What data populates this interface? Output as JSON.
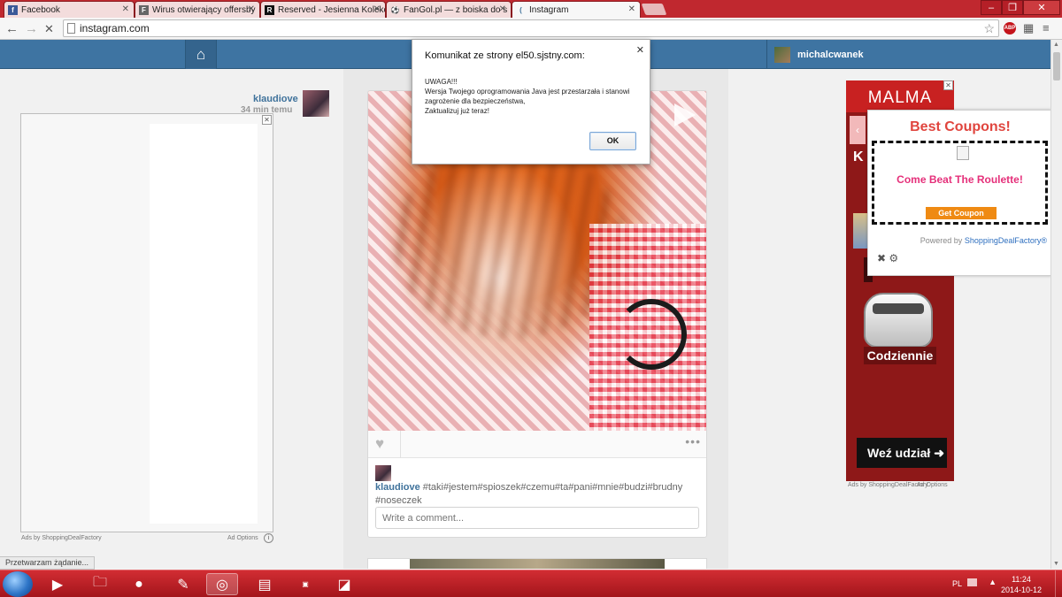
{
  "browser": {
    "tabs": [
      {
        "title": "Facebook",
        "favicon": "f",
        "favicon_color": "#3b5998"
      },
      {
        "title": "Wirus otwierający offersby",
        "favicon": "F",
        "favicon_color": "#666666"
      },
      {
        "title": "Reserved - Jesienna Kolekc",
        "favicon": "R",
        "favicon_color": "#111111"
      },
      {
        "title": "FanGol.pl — z boiska do s",
        "favicon": "⚽",
        "favicon_color": "#e3e3e3"
      },
      {
        "title": "Instagram",
        "favicon": "(",
        "favicon_color": "#3f729b",
        "active": true
      }
    ],
    "address": "instagram.com",
    "status_text": "Przetwarzam żądanie..."
  },
  "instagram": {
    "header_user": "michalcwanek",
    "post": {
      "user": "klaudiove",
      "time": "34 min temu",
      "caption": "#taki#jestem#spioszek#czemu#ta#pani#mnie#budzi#brudny #noseczek",
      "comment_placeholder": "Write a comment..."
    }
  },
  "ads": {
    "left_ads_by": "Ads by ShoppingDealFactory",
    "left_ad_options": "Ad Options",
    "right_ads_by": "Ads by ShoppingDealFactory",
    "right_ad_options": "Ad Options",
    "right_banner": {
      "brand": "MALMA",
      "letter": "K",
      "cta_daily": "Codziennie",
      "cta_join": "Weź udział ➜"
    },
    "coupon": {
      "title": "Best Coupons!",
      "headline": "Come Beat The Roulette!",
      "button": "Get Coupon",
      "powered_prefix": "Powered by ",
      "powered_brand": "ShoppingDealFactory®"
    }
  },
  "dialog": {
    "title": "Komunikat ze strony el50.sjstny.com:",
    "message": "UWAGA!!!\nWersja Twojego oprogramowania Java jest przestarzała i stanowi zagrożenie dla bezpieczeństwa,\nZaktualizuj już teraz!",
    "ok_label": "OK"
  },
  "taskbar": {
    "lang": "PL",
    "time": "11:24",
    "date": "2014-10-12",
    "pinned": [
      "media-player-icon",
      "explorer-icon",
      "security-icon",
      "pin-icon",
      "chrome-icon",
      "archive-icon",
      "gmer-icon",
      "network-icon"
    ]
  }
}
